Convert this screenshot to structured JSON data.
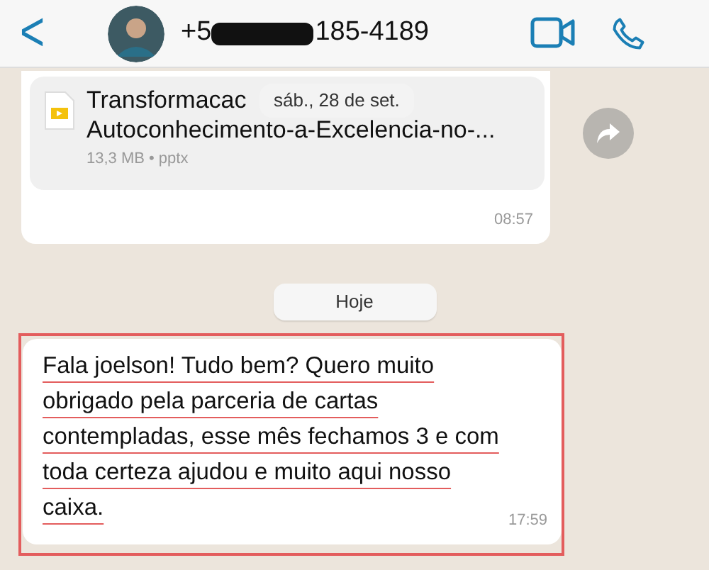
{
  "header": {
    "back": "<",
    "number_start": "+5",
    "number_redacted": true,
    "number_end": "185-4189"
  },
  "file_message": {
    "name_lines": [
      "Transformacac",
      "Autoconhecimento-a-Excelencia-no-..."
    ],
    "meta": "13,3 MB • pptx",
    "time": "08:57"
  },
  "floating_date": "sáb., 28 de set.",
  "date_divider": "Hoje",
  "message": {
    "text": "Fala joelson! Tudo bem? Quero muito obrigado pela parceria de cartas contempladas, esse mês fechamos 3 e com toda certeza ajudou e muito aqui nosso caixa.",
    "time": "17:59",
    "highlighted": true
  }
}
